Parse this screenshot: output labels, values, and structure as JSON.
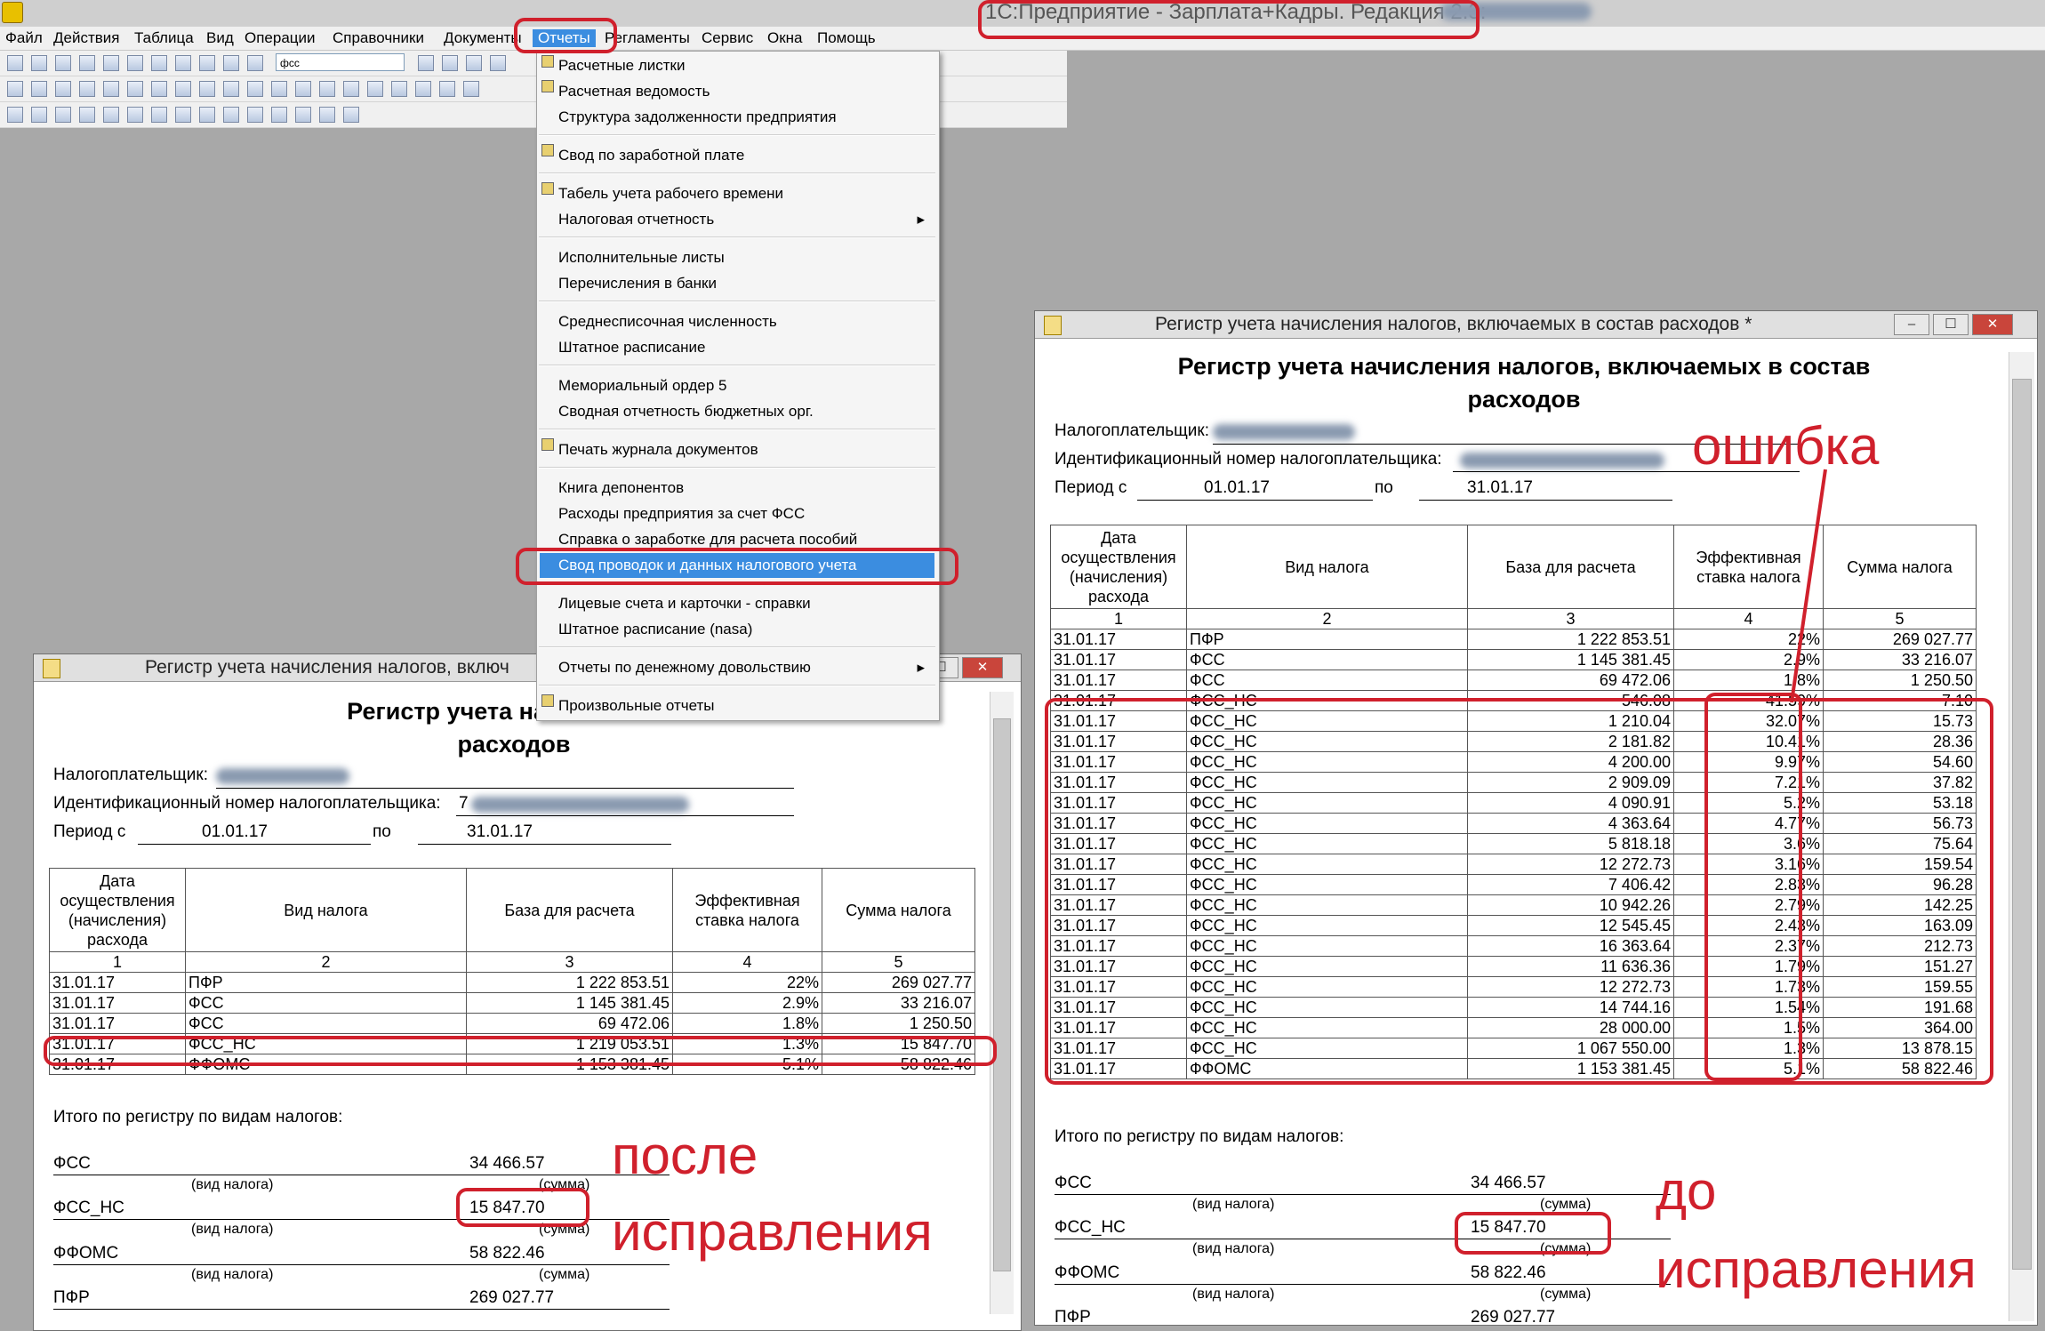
{
  "app": {
    "title": "1С:Предприятие - Зарплата+Кадры. Редакция 2.3:"
  },
  "menu": [
    "Файл",
    "Действия",
    "Таблица",
    "Вид",
    "Операции",
    "Справочники",
    "Документы",
    "Отчеты",
    "Регламенты",
    "Сервис",
    "Окна",
    "Помощь"
  ],
  "toolbar": {
    "combo_value": "фсс"
  },
  "reports_menu": {
    "items": [
      {
        "label": "Расчетные листки"
      },
      {
        "label": "Расчетная ведомость"
      },
      {
        "label": "Структура задолженности предприятия"
      },
      {
        "label": "Свод по заработной плате"
      },
      {
        "label": "Табель учета рабочего времени"
      },
      {
        "label": "Налоговая отчетность",
        "submenu": "▸"
      },
      {
        "label": "Исполнительные листы"
      },
      {
        "label": "Перечисления в банки"
      },
      {
        "label": "Среднесписочная численность"
      },
      {
        "label": "Штатное расписание"
      },
      {
        "label": "Мемориальный ордер 5"
      },
      {
        "label": "Сводная отчетность бюджетных орг."
      },
      {
        "label": "Печать журнала документов"
      },
      {
        "label": "Книга депонентов"
      },
      {
        "label": "Расходы предприятия за счет ФСС"
      },
      {
        "label": "Справка о заработке для расчета пособий"
      },
      {
        "label": "Свод проводок и данных налогового учета"
      },
      {
        "label": "Лицевые счета и карточки - справки"
      },
      {
        "label": "Штатное расписание (nasa)"
      },
      {
        "label": "Отчеты по денежному довольствию",
        "submenu": "▸"
      },
      {
        "label": "Произвольные отчеты"
      }
    ]
  },
  "report": {
    "window_title": "Регистр учета начисления налогов, включаемых в состав расходов",
    "window_title_short": "Регистр учета начисления налогов, включ",
    "modified_mark": "*",
    "heading_line1": "Регистр учета начисления налогов, включаемых в состав",
    "heading_line2": "расходов",
    "heading_line1_short": "Регистр учета начисления н",
    "taxpayer_label": "Налогоплательщик:",
    "inn_label": "Идентификационный номер налогоплательщика:",
    "inn_prefix": "7",
    "period_from_label": "Период с",
    "period_from": "01.01.17",
    "period_to_label": "по",
    "period_to": "31.01.17",
    "columns": [
      "Дата осуществления (начисления) расхода",
      "Вид налога",
      "База для расчета",
      "Эффективная ставка налога",
      "Сумма налога"
    ],
    "column_numbers": [
      "1",
      "2",
      "3",
      "4",
      "5"
    ],
    "totals_title": "Итого по регистру по видам налогов:",
    "hint_type": "(вид налога)",
    "hint_sum": "(сумма)",
    "controls": {
      "minimize": "–",
      "maximize": "☐",
      "close": "✕"
    }
  },
  "after": {
    "rows": [
      {
        "date": "31.01.17",
        "type": "ПФР",
        "base": "1 222 853.51",
        "rate": "22%",
        "sum": "269 027.77"
      },
      {
        "date": "31.01.17",
        "type": "ФСС",
        "base": "1 145 381.45",
        "rate": "2.9%",
        "sum": "33 216.07"
      },
      {
        "date": "31.01.17",
        "type": "ФСС",
        "base": "69 472.06",
        "rate": "1.8%",
        "sum": "1 250.50"
      },
      {
        "date": "31.01.17",
        "type": "ФСС_НС",
        "base": "1 219 053.51",
        "rate": "1.3%",
        "sum": "15 847.70"
      },
      {
        "date": "31.01.17",
        "type": "ФФОМС",
        "base": "1 153 381.45",
        "rate": "5.1%",
        "sum": "58 822.46"
      }
    ],
    "totals": [
      {
        "name": "ФСС",
        "value": "34 466.57"
      },
      {
        "name": "ФСС_НС",
        "value": "15 847.70"
      },
      {
        "name": "ФФОМС",
        "value": "58 822.46"
      },
      {
        "name": "ПФР",
        "value": "269 027.77"
      }
    ]
  },
  "before": {
    "rows": [
      {
        "date": "31.01.17",
        "type": "ПФР",
        "base": "1 222 853.51",
        "rate": "22%",
        "sum": "269 027.77"
      },
      {
        "date": "31.01.17",
        "type": "ФСС",
        "base": "1 145 381.45",
        "rate": "2.9%",
        "sum": "33 216.07"
      },
      {
        "date": "31.01.17",
        "type": "ФСС",
        "base": "69 472.06",
        "rate": "1.8%",
        "sum": "1 250.50"
      },
      {
        "date": "31.01.17",
        "type": "ФСС_НС",
        "base": "546.08",
        "rate": "41.59%",
        "sum": "7.10"
      },
      {
        "date": "31.01.17",
        "type": "ФСС_НС",
        "base": "1 210.04",
        "rate": "32.07%",
        "sum": "15.73"
      },
      {
        "date": "31.01.17",
        "type": "ФСС_НС",
        "base": "2 181.82",
        "rate": "10.41%",
        "sum": "28.36"
      },
      {
        "date": "31.01.17",
        "type": "ФСС_НС",
        "base": "4 200.00",
        "rate": "9.97%",
        "sum": "54.60"
      },
      {
        "date": "31.01.17",
        "type": "ФСС_НС",
        "base": "2 909.09",
        "rate": "7.21%",
        "sum": "37.82"
      },
      {
        "date": "31.01.17",
        "type": "ФСС_НС",
        "base": "4 090.91",
        "rate": "5.2%",
        "sum": "53.18"
      },
      {
        "date": "31.01.17",
        "type": "ФСС_НС",
        "base": "4 363.64",
        "rate": "4.77%",
        "sum": "56.73"
      },
      {
        "date": "31.01.17",
        "type": "ФСС_НС",
        "base": "5 818.18",
        "rate": "3.6%",
        "sum": "75.64"
      },
      {
        "date": "31.01.17",
        "type": "ФСС_НС",
        "base": "12 272.73",
        "rate": "3.16%",
        "sum": "159.54"
      },
      {
        "date": "31.01.17",
        "type": "ФСС_НС",
        "base": "7 406.42",
        "rate": "2.83%",
        "sum": "96.28"
      },
      {
        "date": "31.01.17",
        "type": "ФСС_НС",
        "base": "10 942.26",
        "rate": "2.79%",
        "sum": "142.25"
      },
      {
        "date": "31.01.17",
        "type": "ФСС_НС",
        "base": "12 545.45",
        "rate": "2.43%",
        "sum": "163.09"
      },
      {
        "date": "31.01.17",
        "type": "ФСС_НС",
        "base": "16 363.64",
        "rate": "2.37%",
        "sum": "212.73"
      },
      {
        "date": "31.01.17",
        "type": "ФСС_НС",
        "base": "11 636.36",
        "rate": "1.79%",
        "sum": "151.27"
      },
      {
        "date": "31.01.17",
        "type": "ФСС_НС",
        "base": "12 272.73",
        "rate": "1.73%",
        "sum": "159.55"
      },
      {
        "date": "31.01.17",
        "type": "ФСС_НС",
        "base": "14 744.16",
        "rate": "1.54%",
        "sum": "191.68"
      },
      {
        "date": "31.01.17",
        "type": "ФСС_НС",
        "base": "28 000.00",
        "rate": "1.5%",
        "sum": "364.00"
      },
      {
        "date": "31.01.17",
        "type": "ФСС_НС",
        "base": "1 067 550.00",
        "rate": "1.3%",
        "sum": "13 878.15"
      },
      {
        "date": "31.01.17",
        "type": "ФФОМС",
        "base": "1 153 381.45",
        "rate": "5.1%",
        "sum": "58 822.46"
      }
    ],
    "totals": [
      {
        "name": "ФСС",
        "value": "34 466.57"
      },
      {
        "name": "ФСС_НС",
        "value": "15 847.70"
      },
      {
        "name": "ФФОМС",
        "value": "58 822.46"
      },
      {
        "name": "ПФР",
        "value": "269 027.77"
      }
    ]
  },
  "annotations": {
    "error": "ошибка",
    "after_line1": "после",
    "after_line2": "исправления",
    "before_line1": "до",
    "before_line2": "исправления"
  },
  "colors": {
    "highlight": "#d0202c",
    "menu_selection": "#3b8de0",
    "workspace": "#a8a8a8"
  }
}
